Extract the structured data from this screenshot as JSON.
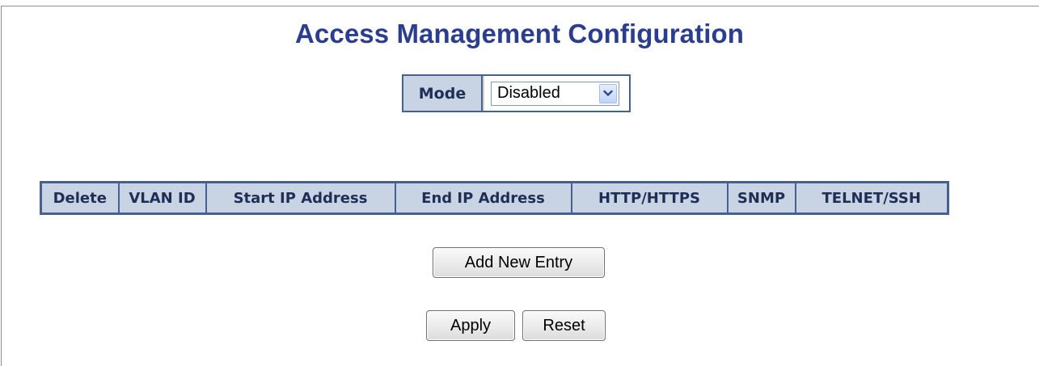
{
  "page": {
    "title": "Access Management Configuration"
  },
  "mode": {
    "label": "Mode",
    "selected": "Disabled"
  },
  "access_table": {
    "headers": [
      "Delete",
      "VLAN ID",
      "Start IP Address",
      "End IP Address",
      "HTTP/HTTPS",
      "SNMP",
      "TELNET/SSH"
    ]
  },
  "buttons": {
    "add_new_entry": "Add New Entry",
    "apply": "Apply",
    "reset": "Reset"
  },
  "colors": {
    "title": "#2b3d8f",
    "header_bg": "#c8d3e4",
    "border": "#46618f"
  },
  "icons": {
    "dropdown": "chevron-down-icon"
  }
}
